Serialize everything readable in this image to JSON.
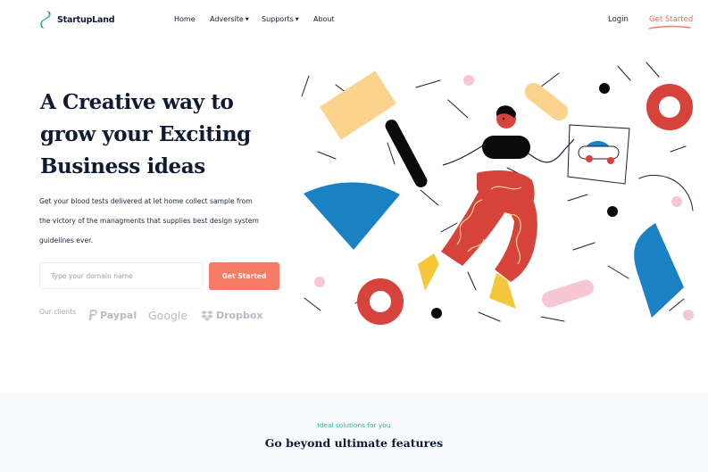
{
  "brand": {
    "name": "StartupLand"
  },
  "nav": {
    "items": [
      {
        "label": "Home",
        "has_dropdown": false
      },
      {
        "label": "Adversite",
        "has_dropdown": true
      },
      {
        "label": "Supports",
        "has_dropdown": true
      },
      {
        "label": "About",
        "has_dropdown": false
      }
    ],
    "login_label": "Login",
    "cta_label": "Get Started"
  },
  "hero": {
    "title_lines": [
      "A Creative way to",
      "grow your Exciting",
      "Business ideas"
    ],
    "description_lines": [
      "Get your blood tests delivered at let home collect sample from",
      "the victory of the managments that supplies best design system",
      "guidelines ever."
    ],
    "domain_input": {
      "placeholder": "Type your domain name",
      "value": ""
    },
    "cta_label": "Get Started",
    "clients_label": "Our clients",
    "clients": [
      "Paypal",
      "Google",
      "Dropbox"
    ]
  },
  "features": {
    "eyebrow": "Ideal solutions for you",
    "title": "Go beyond ultimate features"
  },
  "colors": {
    "accent": "#f47b65",
    "navy": "#0f1a33",
    "teal": "#2bb3a5",
    "blue": "#1a82c4",
    "red": "#d6433b",
    "yellow": "#fbd38d",
    "pink": "#f6c6d4"
  },
  "icons": {
    "logo": "startupland-logo-icon",
    "paypal": "paypal-logo-icon",
    "dropbox": "dropbox-logo-icon",
    "caret": "chevron-down-icon"
  }
}
